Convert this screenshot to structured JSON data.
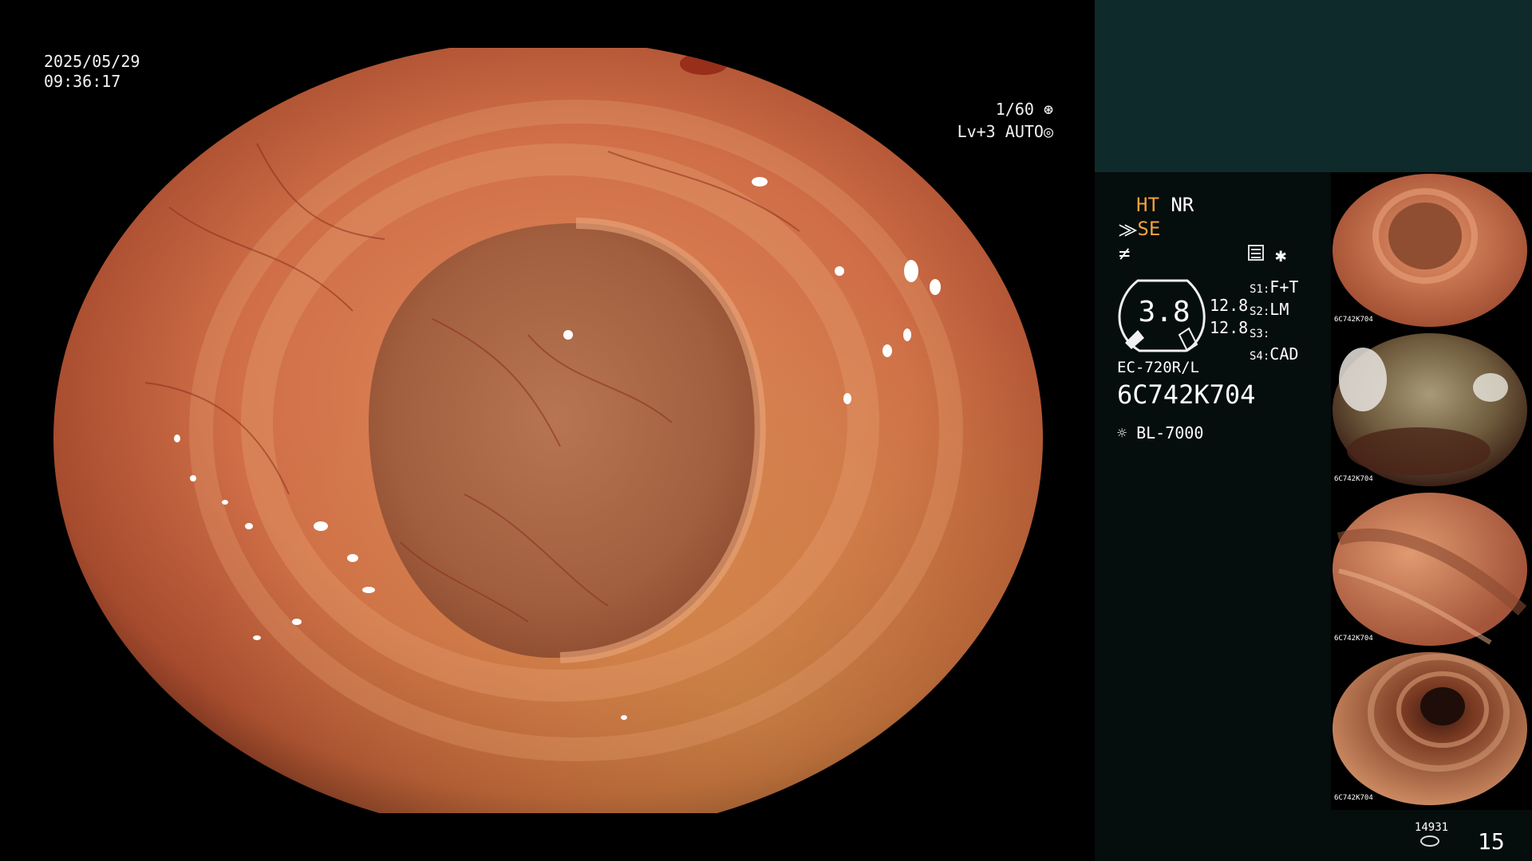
{
  "overlay": {
    "date": "2025/05/29",
    "time": "09:36:17",
    "shutter": "1/60",
    "level": "Lv+3",
    "exposure_mode": "AUTO"
  },
  "panel": {
    "ht_label": "HT",
    "nr_label": "NR",
    "se_label": "SE",
    "zoom_value": "3.8",
    "value_1": "12.8",
    "value_2": "12.8",
    "s1": "S1",
    "s1_value": "F+T",
    "s2": "S2",
    "s2_value": "LM",
    "s3": "S3",
    "s3_value": "",
    "s4": "S4",
    "s4_value": "CAD",
    "scope_model": "EC-720R/L",
    "scope_serial": "6C742K704",
    "light_source": "BL-7000",
    "storage_count": "14931",
    "image_count": "15"
  },
  "thumbnails": [
    {
      "label": "6C742K704",
      "scene": "lumen-ring"
    },
    {
      "label": "6C742K704",
      "scene": "debris"
    },
    {
      "label": "6C742K704",
      "scene": "fold"
    },
    {
      "label": "6C742K704",
      "scene": "deep-lumen"
    }
  ],
  "colors": {
    "panel_bg": "#050d0d",
    "panel_top": "#0f2a2a",
    "accent_orange": "#f2a23a",
    "tissue": "#c0623f"
  }
}
